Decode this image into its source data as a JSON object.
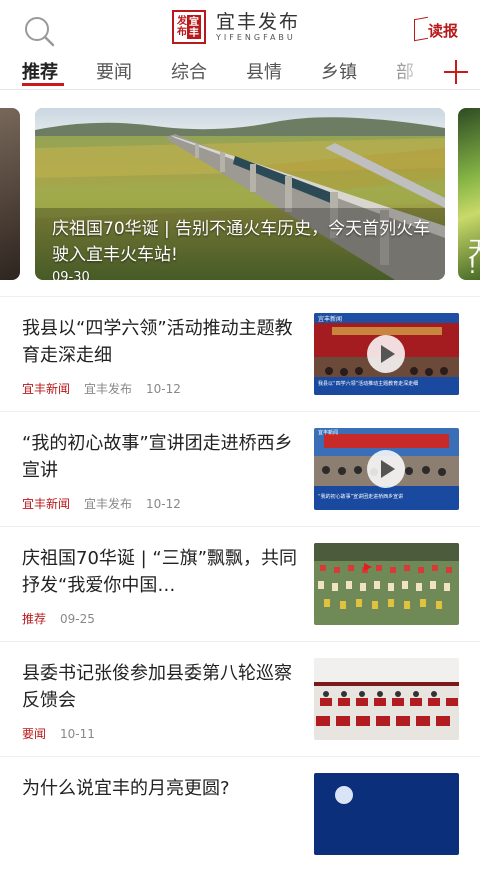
{
  "header": {
    "logo_seal_chars": [
      "发",
      "布",
      "宜",
      "丰"
    ],
    "logo_cn": "宜丰发布",
    "logo_en": "YIFENGFABU",
    "read_label": "读报",
    "icons": {
      "search": "search-icon",
      "read": "newspaper-icon",
      "add": "plus-icon"
    }
  },
  "tabs": [
    {
      "label": "推荐",
      "active": true
    },
    {
      "label": "要闻",
      "active": false
    },
    {
      "label": "综合",
      "active": false
    },
    {
      "label": "县情",
      "active": false
    },
    {
      "label": "乡镇",
      "active": false
    },
    {
      "label": "部",
      "active": false
    }
  ],
  "carousel": {
    "right_peek_text": [
      "天",
      "!"
    ],
    "main": {
      "caption": "庆祖国70华诞 | 告别不通火车历史，今天首列火车驶入宜丰火车站!",
      "date": "09-30"
    }
  },
  "news": [
    {
      "title": "我县以“四学六领”活动推动主题教育走深走细",
      "source": "宜丰新闻",
      "author": "宜丰发布",
      "date": "10-12",
      "video": true,
      "thumb_banner": "宜丰新闻",
      "thumb_caption": "我县以“四学六领”活动推动主题教育走深走细"
    },
    {
      "title": "“我的初心故事”宣讲团走进桥西乡宣讲",
      "source": "宜丰新闻",
      "author": "宜丰发布",
      "date": "10-12",
      "video": true,
      "thumb_banner": "宜丰新闻",
      "thumb_caption": "“我的初心故事”宣讲团走进桥西乡宣讲"
    },
    {
      "title": "庆祖国70华诞 | “三旗”飘飘，共同抒发“我爱你中国…",
      "source": "推荐",
      "author": "",
      "date": "09-25",
      "video": false
    },
    {
      "title": "县委书记张俊参加县委第八轮巡察反馈会",
      "source": "要闻",
      "author": "",
      "date": "10-11",
      "video": false
    },
    {
      "title": "为什么说宜丰的月亮更圆?",
      "source": "",
      "author": "",
      "date": "",
      "video": false
    }
  ],
  "colors": {
    "accent": "#c81b1e",
    "brand_red": "#b8191b"
  }
}
